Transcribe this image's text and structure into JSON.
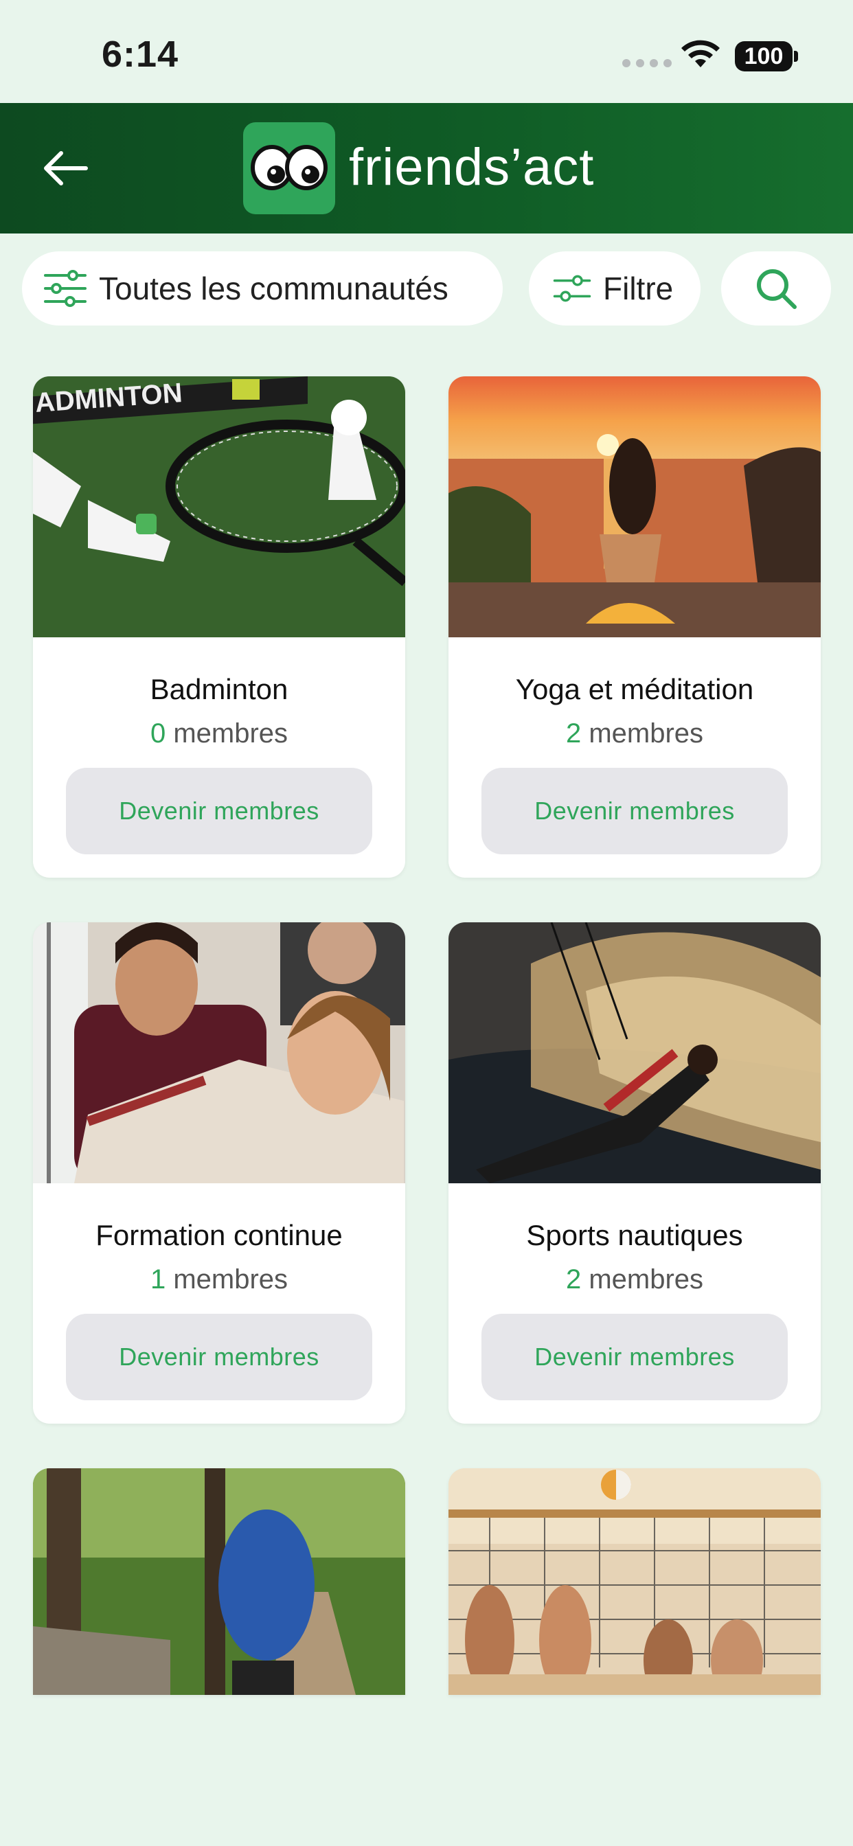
{
  "status_bar": {
    "time": "6:14",
    "battery": "100"
  },
  "header": {
    "brand": "friends’act",
    "back_icon": "arrow-left-icon",
    "logo_icon": "googly-eyes-logo",
    "colors": {
      "start": "#0d4a20",
      "end": "#166e2e"
    }
  },
  "filters": {
    "communities_label": "Toutes les communautés",
    "filter_label": "Filtre",
    "sliders_icon": "sliders-icon",
    "search_icon": "search-icon"
  },
  "accent_color": "#2fa55a",
  "communities": [
    {
      "name": "Badminton",
      "count": "0",
      "unit": " membres",
      "action": "Devenir membres"
    },
    {
      "name": "Yoga et méditation",
      "count": "2",
      "unit": " membres",
      "action": "Devenir membres"
    },
    {
      "name": "Formation continue",
      "count": "1",
      "unit": " membres",
      "action": "Devenir membres"
    },
    {
      "name": "Sports nautiques",
      "count": "2",
      "unit": " membres",
      "action": "Devenir membres"
    },
    {
      "name": "",
      "count": "",
      "unit": "",
      "action": ""
    },
    {
      "name": "",
      "count": "",
      "unit": "",
      "action": ""
    }
  ]
}
